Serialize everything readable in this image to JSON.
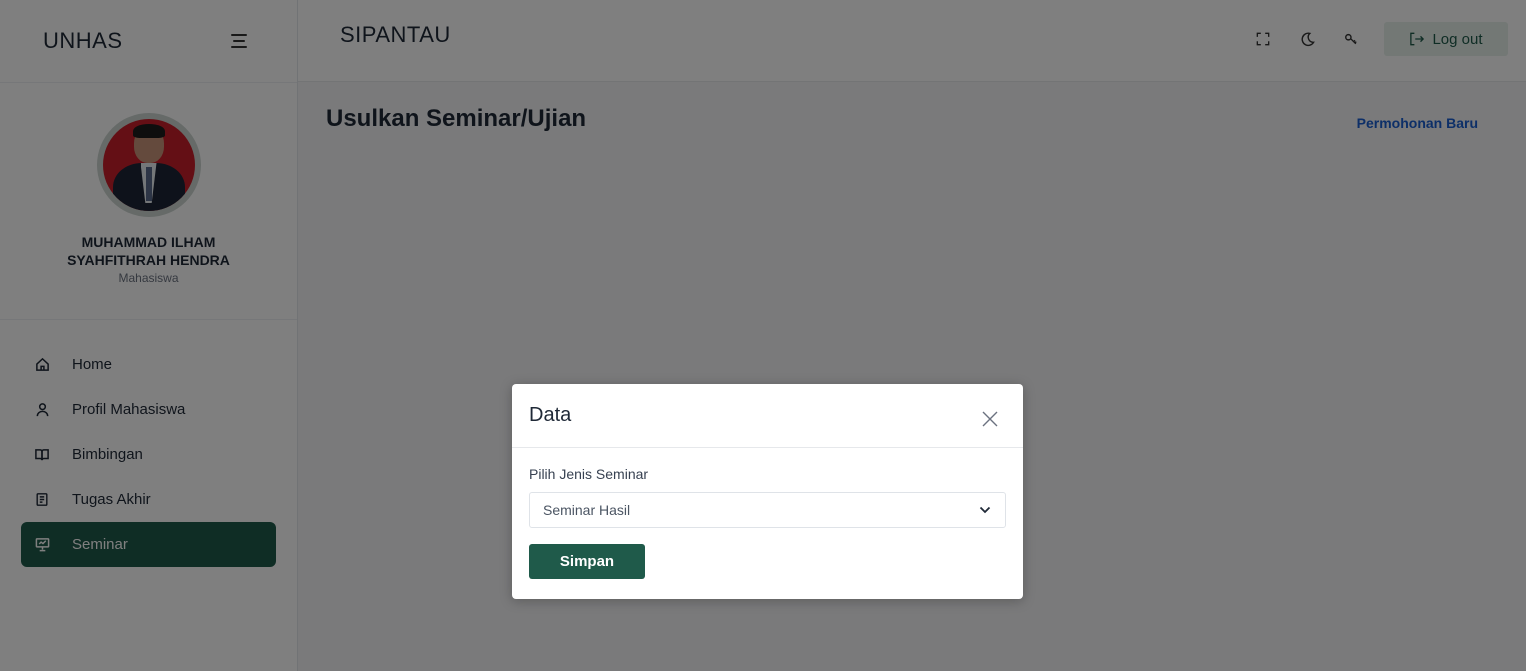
{
  "sidebar": {
    "brand": "UNHAS",
    "profile": {
      "name": "MUHAMMAD ILHAM SYAHFITHRAH HENDRA",
      "role": "Mahasiswa"
    },
    "items": [
      {
        "label": "Home",
        "icon": "home-icon"
      },
      {
        "label": "Profil Mahasiswa",
        "icon": "user-icon"
      },
      {
        "label": "Bimbingan",
        "icon": "book-open-icon"
      },
      {
        "label": "Tugas Akhir",
        "icon": "document-icon"
      },
      {
        "label": "Seminar",
        "icon": "presentation-icon",
        "active": true
      }
    ]
  },
  "header": {
    "title": "SIPANTAU",
    "tools": [
      "fullscreen-icon",
      "moon-icon",
      "key-icon"
    ],
    "logout_label": "Log out"
  },
  "main": {
    "title": "Usulkan Seminar/Ujian",
    "new_link": "Permohonan Baru"
  },
  "modal": {
    "title": "Data",
    "field_label": "Pilih Jenis Seminar",
    "selected_value": "Seminar Hasil",
    "save_label": "Simpan"
  },
  "colors": {
    "primary": "#1f5a4a",
    "link": "#1a5fd0",
    "overlay": "rgba(0,0,0,0.5)"
  }
}
